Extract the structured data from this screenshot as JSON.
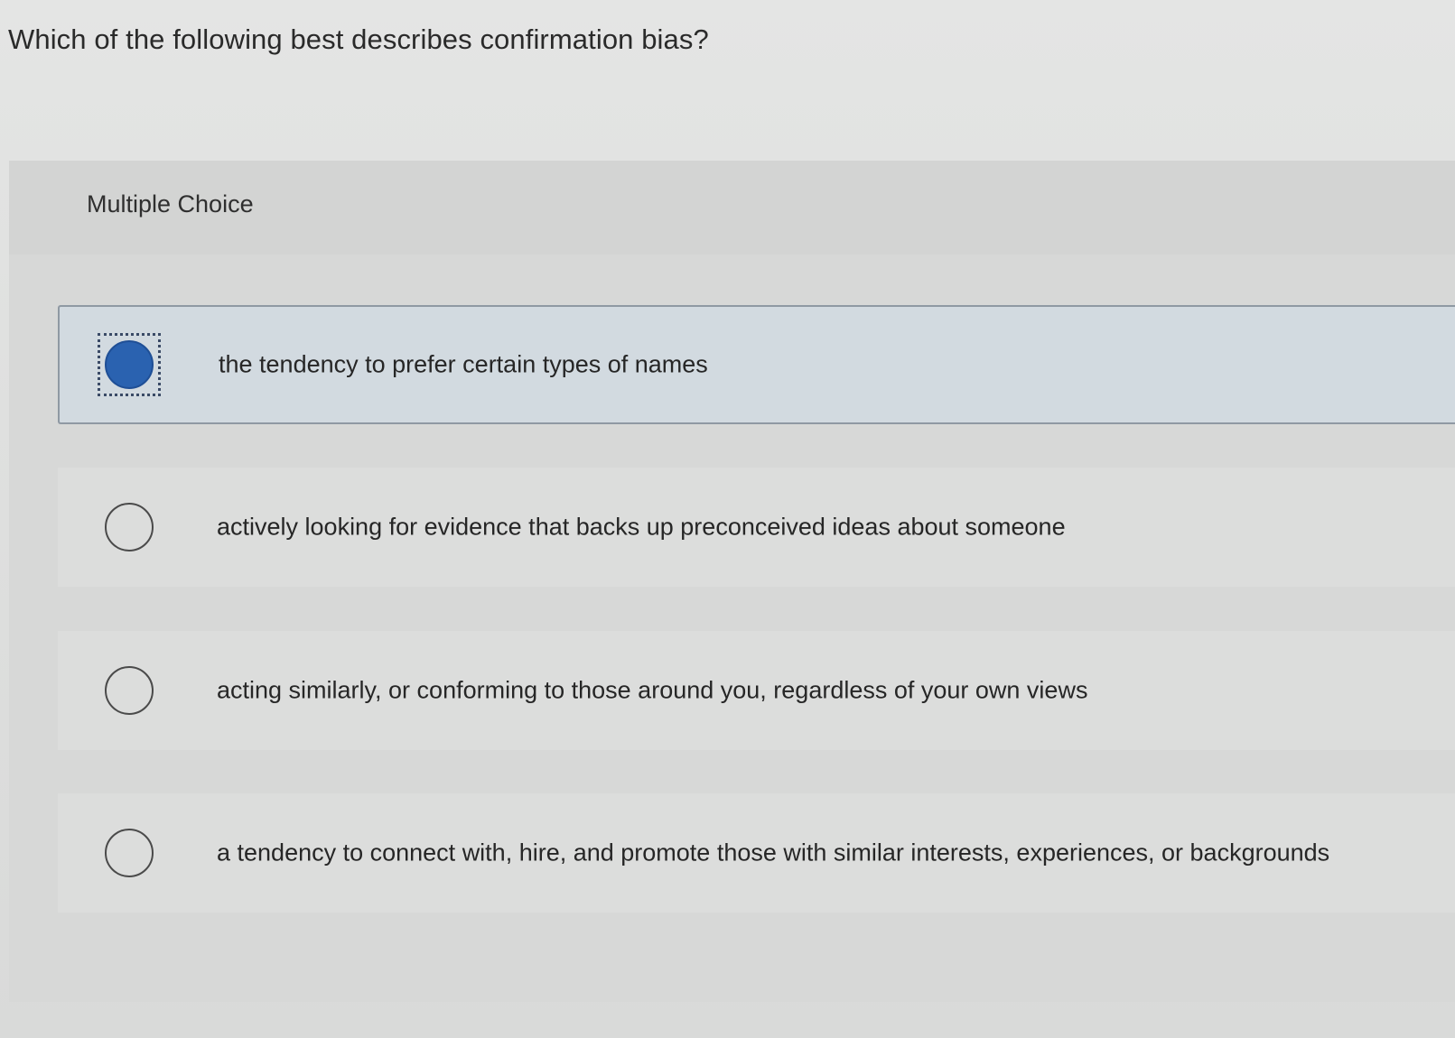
{
  "question": {
    "text": "Which of the following best describes confirmation bias?"
  },
  "panel": {
    "type_label": "Multiple Choice"
  },
  "choices": [
    {
      "label": "the tendency to prefer certain types of names",
      "selected": true
    },
    {
      "label": "actively looking for evidence that backs up preconceived ideas about someone",
      "selected": false
    },
    {
      "label": "acting similarly, or conforming to those around you, regardless of your own views",
      "selected": false
    },
    {
      "label": "a tendency to connect with, hire, and promote those with similar interests, experiences, or backgrounds",
      "selected": false
    }
  ],
  "colors": {
    "accent": "#2a62b0",
    "selected_background": "#d2dae0"
  }
}
